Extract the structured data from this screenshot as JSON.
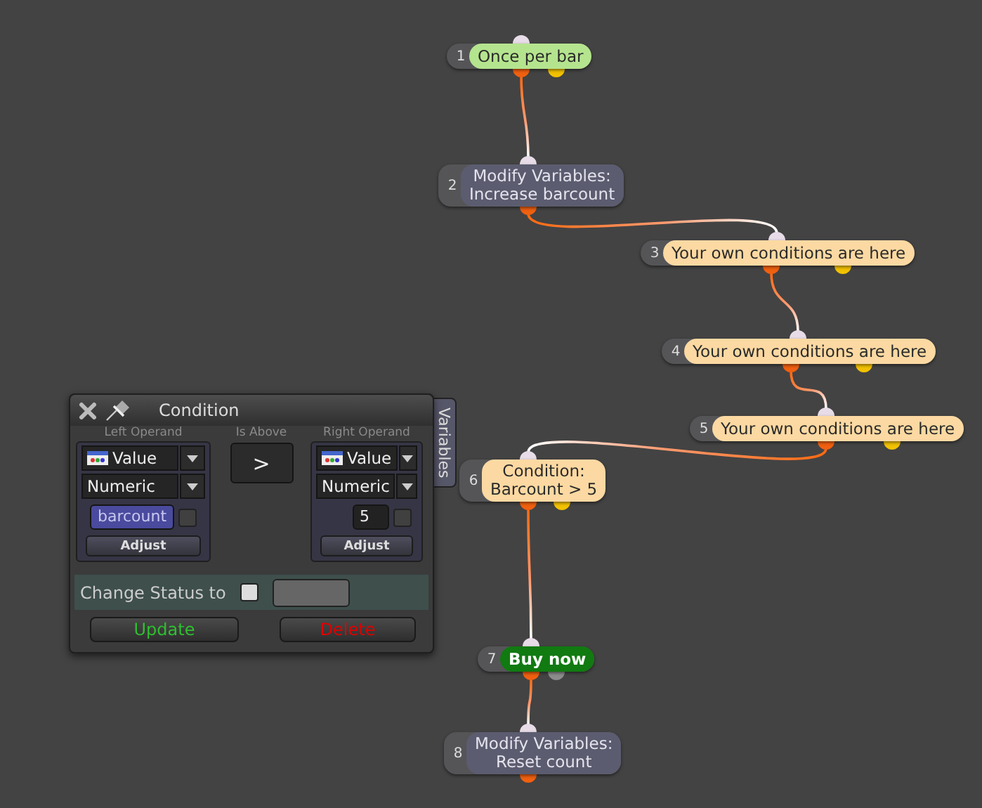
{
  "canvas": {
    "nodes": [
      {
        "number": "1",
        "lines": [
          "Once per bar"
        ],
        "kind": "trigger"
      },
      {
        "number": "2",
        "lines": [
          "Modify Variables:",
          "Increase barcount"
        ],
        "kind": "action"
      },
      {
        "number": "3",
        "lines": [
          "Your own conditions are here"
        ],
        "kind": "condition"
      },
      {
        "number": "4",
        "lines": [
          "Your own conditions are here"
        ],
        "kind": "condition"
      },
      {
        "number": "5",
        "lines": [
          "Your own conditions are here"
        ],
        "kind": "condition"
      },
      {
        "number": "6",
        "lines": [
          "Condition:",
          "Barcount > 5"
        ],
        "kind": "condition"
      },
      {
        "number": "7",
        "lines": [
          "Buy now"
        ],
        "kind": "order"
      },
      {
        "number": "8",
        "lines": [
          "Modify Variables:",
          "Reset count"
        ],
        "kind": "action"
      }
    ]
  },
  "dialog": {
    "title": "Condition",
    "side_tab": "Variables",
    "left_operand": {
      "label": "Left Operand",
      "source": "Value",
      "type": "Numeric",
      "value": "barcount",
      "kind": "variable",
      "checked": false,
      "button": "Adjust"
    },
    "operator": {
      "label": "Is Above",
      "symbol": ">"
    },
    "right_operand": {
      "label": "Right Operand",
      "source": "Value",
      "type": "Numeric",
      "value": "5",
      "kind": "constant",
      "checked": false,
      "button": "Adjust"
    },
    "change_status": {
      "label": "Change Status to",
      "checked": false
    },
    "buttons": [
      {
        "label": "Update",
        "kind": "confirm"
      },
      {
        "label": "Delete",
        "kind": "danger"
      }
    ]
  }
}
